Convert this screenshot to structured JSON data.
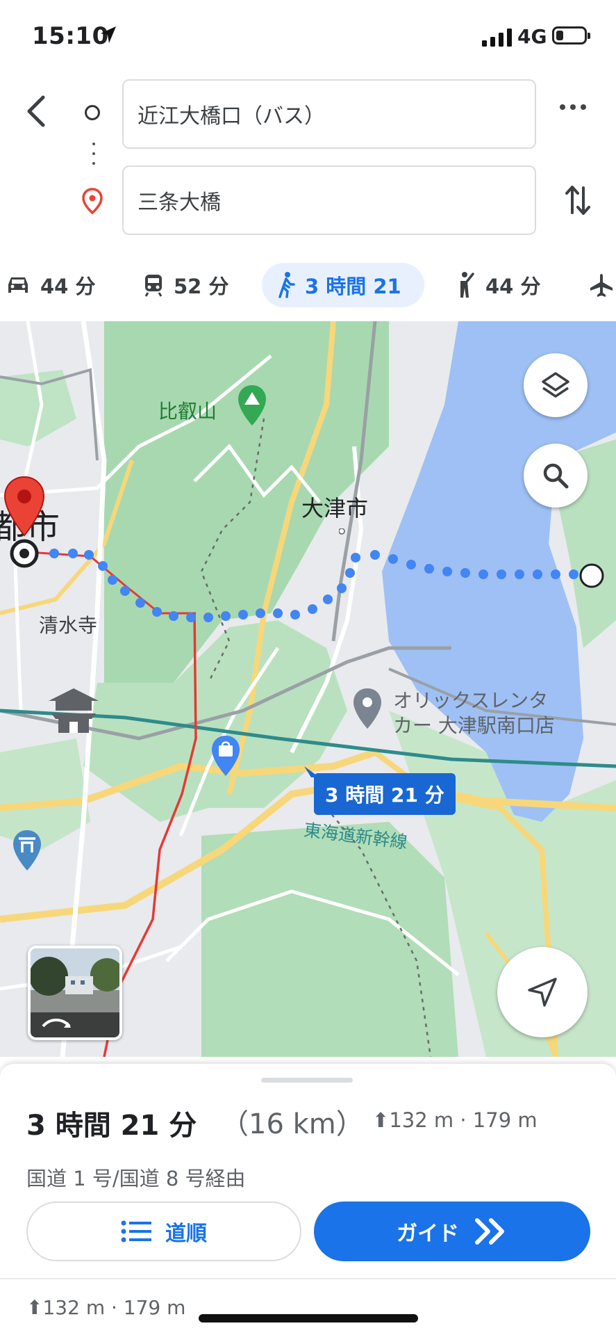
{
  "status_bar": {
    "time": "15:10",
    "network": "4G",
    "battery_level": 0.25
  },
  "route": {
    "from": "近江大橋口（バス）",
    "to": "三条大橋"
  },
  "modes": [
    {
      "icon": "car-icon",
      "label": "44 分"
    },
    {
      "icon": "train-icon",
      "label": "52 分"
    },
    {
      "icon": "walk-icon",
      "label": "3 時間 21",
      "active": true
    },
    {
      "icon": "ride-hail-icon",
      "label": "44 分"
    },
    {
      "icon": "flight-icon",
      "label": ""
    }
  ],
  "map": {
    "labels": {
      "mountain": "比叡山",
      "city": "大津市",
      "city_partial": "都市",
      "temple": "清水寺",
      "rental_line1": "オリックスレンタ",
      "rental_line2": "カー 大津駅南口店",
      "railway": "東海道新幹線"
    },
    "route_bubble": "3 時間 21 分",
    "colors": {
      "water": "#9ec0f5",
      "park": "#a8d8b0",
      "route": "#4285f4",
      "pin": "#ea4335"
    }
  },
  "summary": {
    "duration": "3 時間 21 分",
    "distance": "（16 km）",
    "elevation": "132 m · 179 m",
    "via": "国道 1 号/国道 8 号経由"
  },
  "buttons": {
    "steps": "道順",
    "guide": "ガイド"
  },
  "footer": {
    "elevation": "132 m · 179 m"
  }
}
